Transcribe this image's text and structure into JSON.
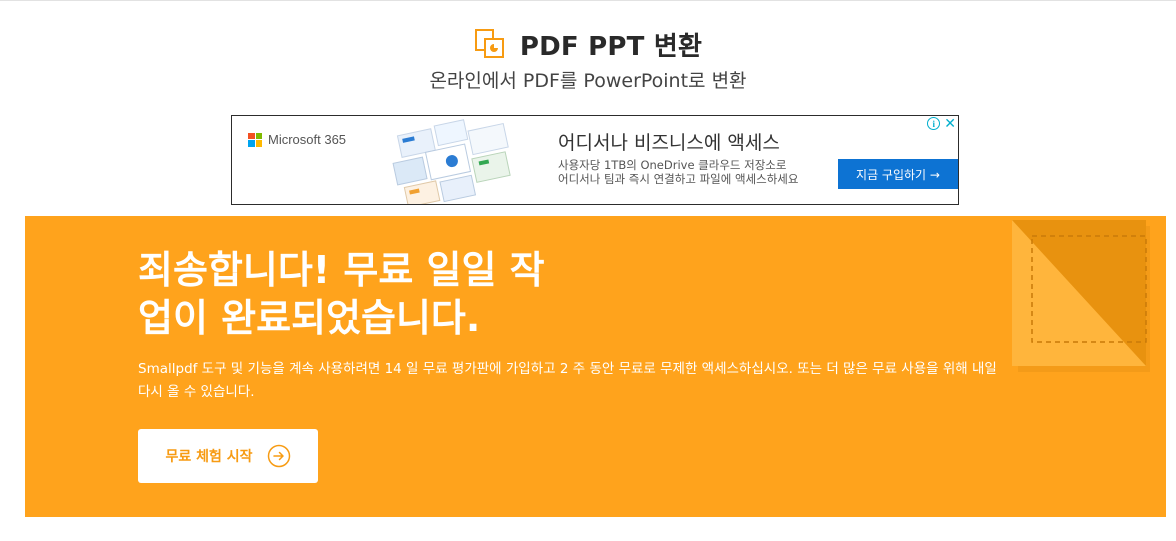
{
  "header": {
    "title": "PDF PPT 변환",
    "subtitle": "온라인에서 PDF를 PowerPoint로 변환",
    "icon": "pdf-to-ppt-icon"
  },
  "ad": {
    "brand": "Microsoft 365",
    "headline": "어디서나 비즈니스에 액세스",
    "desc_line1": "사용자당 1TB의 OneDrive 클라우드 저장소로",
    "desc_line2": "어디서나 팀과 즉시 연결하고 파일에 액세스하세요",
    "cta": "지금 구입하기 →",
    "info_icon": "info-icon",
    "close_icon": "close-icon",
    "cta_color": "#0d73d3"
  },
  "banner": {
    "title_line1": "죄송합니다! 무료 일일 작",
    "title_line2": "업이 완료되었습니다.",
    "text": "Smallpdf 도구 및 기능을 계속 사용하려면 14 일 무료 평가판에 가입하고 2 주 동안 무료로 무제한 액세스하십시오. 또는 더 많은 무료 사용을 위해 내일 다시 올 수 있습니다.",
    "button_label": "무료 체험 시작",
    "button_icon": "arrow-right-circle-icon",
    "background_color": "#ffa31c"
  },
  "colors": {
    "accent": "#f79b12"
  }
}
